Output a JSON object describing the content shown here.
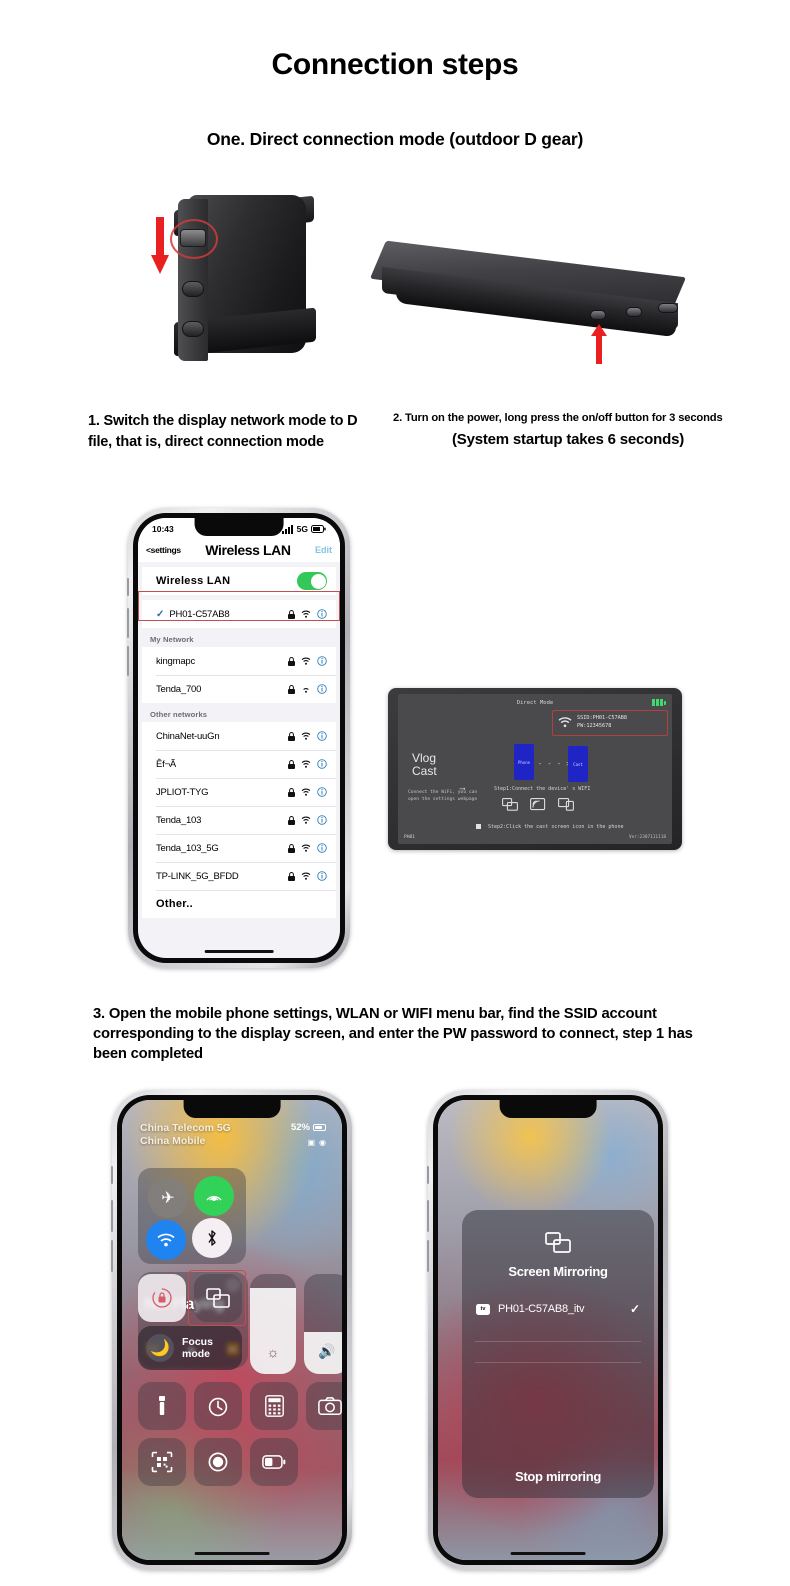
{
  "page": {
    "title": "Connection steps",
    "section_one": "One. Direct connection mode (outdoor D gear)"
  },
  "steps": {
    "step1": "1. Switch the display network mode to D file, that is, direct connection mode",
    "step2_line1": "2. Turn on the power, long press the on/off button for 3 seconds",
    "step2_line2": "(System startup takes 6 seconds)",
    "step3": "3. Open the mobile phone settings, WLAN or WIFI menu bar, find the SSID account corresponding to the display screen, and enter the PW password to connect, step 1 has been completed"
  },
  "wifi_phone": {
    "status": {
      "time": "10:43",
      "network": "5G",
      "signal_icon": "signal-bars-icon",
      "battery_icon": "battery-icon"
    },
    "nav": {
      "back": "<settings",
      "title": "Wireless LAN",
      "edit": "Edit"
    },
    "toggle_row": {
      "label": "Wireless LAN",
      "state": "on"
    },
    "connected": {
      "name": "PH01-C57AB8",
      "checked": true
    },
    "groups": [
      {
        "header": "My Network",
        "rows": [
          {
            "name": "kingmapc"
          },
          {
            "name": "Tenda_700"
          }
        ]
      },
      {
        "header": "Other networks",
        "rows": [
          {
            "name": "ChinaNet-uuGn"
          },
          {
            "name": "Êf¬Ã"
          },
          {
            "name": "JPLIOT-TYG"
          },
          {
            "name": "Tenda_103"
          },
          {
            "name": "Tenda_103_5G"
          },
          {
            "name": "TP-LINK_5G_BFDD"
          }
        ]
      }
    ],
    "other_label": "Other.."
  },
  "tablet": {
    "mode": "Direct Mode",
    "ssid_line": "SSID:PH01-C57AB8",
    "pw_line": "PW:12345678",
    "wifi_caption": "WiFi",
    "logo_line1": "Vlog",
    "logo_line2": "Cast",
    "note": "Connect the WiFi, you can open the settings webpage",
    "box_phone": "Phone",
    "box_cast": "Cast",
    "dash_arrow": "- - - >",
    "step1": "Step1:Connect the device' s WIFI",
    "step2": "Step2:Click the cast screen icon in the phone",
    "model": "PH01",
    "version": "Ver:2307111118"
  },
  "control_center": {
    "carrier_line1": "China Telecom 5G",
    "carrier_line2": "China Mobile",
    "battery_percent": "52%",
    "media_title": "Not Playing",
    "focus_label_line1": "Focus",
    "focus_label_line2": "mode",
    "tiles": [
      "airplane-mode-icon",
      "cellular-data-icon",
      "wifi-icon",
      "bluetooth-icon",
      "rotation-lock-icon",
      "screen-mirroring-icon",
      "brightness-slider",
      "volume-slider",
      "flashlight-icon",
      "timer-icon",
      "calculator-icon",
      "camera-icon",
      "qr-scanner-icon",
      "screen-record-icon",
      "low-power-icon"
    ]
  },
  "screen_mirroring": {
    "title": "Screen Mirroring",
    "device": "PH01-C57AB8_itv",
    "device_checked": true,
    "stop_label": "Stop mirroring"
  },
  "colors": {
    "highlight_red": "#c0504d",
    "arrow_red": "#e8201f",
    "toggle_green": "#34c759",
    "edit_blue": "#7fc6e0"
  }
}
